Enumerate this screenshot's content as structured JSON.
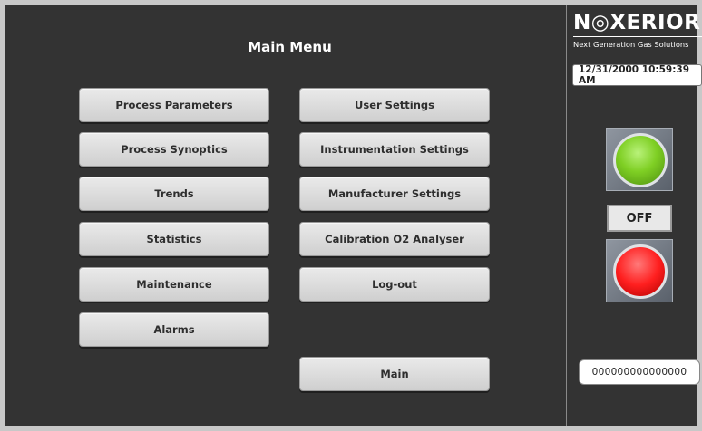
{
  "main": {
    "title": "Main Menu",
    "buttons_left": [
      "Process Parameters",
      "Process Synoptics",
      "Trends",
      "Statistics",
      "Maintenance",
      "Alarms"
    ],
    "buttons_right": [
      "User Settings",
      "Instrumentation Settings",
      "Manufacturer Settings",
      "Calibration O2 Analyser",
      "Log-out"
    ],
    "main_button": "Main"
  },
  "side": {
    "logo": "N◎XERIOR",
    "tagline": "Next Generation Gas Solutions",
    "datetime": "12/31/2000 10:59:39 AM",
    "status": "OFF",
    "counter": "000000000000000",
    "colors": {
      "green_lamp": "#7fcf24",
      "red_lamp": "#ff1f1f",
      "background": "#333333"
    }
  }
}
